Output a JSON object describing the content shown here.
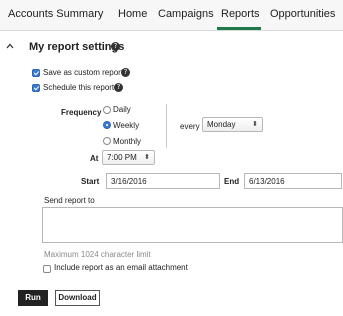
{
  "nav": {
    "tabs": [
      {
        "label": "Accounts Summary"
      },
      {
        "label": "Home"
      },
      {
        "label": "Campaigns"
      },
      {
        "label": "Reports"
      },
      {
        "label": "Opportunities"
      }
    ],
    "active_tab": "Reports"
  },
  "settings": {
    "title": "My report settings",
    "save_custom_label": "Save as custom report",
    "save_custom_checked": true,
    "schedule_label": "Schedule this report",
    "schedule_checked": true
  },
  "schedule": {
    "frequency_label": "Frequency",
    "options": [
      {
        "label": "Daily",
        "selected": false
      },
      {
        "label": "Weekly",
        "selected": true
      },
      {
        "label": "Monthly",
        "selected": false
      }
    ],
    "every_label": "every",
    "day_value": "Monday",
    "at_label": "At",
    "time_value": "7:00 PM",
    "start_label": "Start",
    "start_value": "3/16/2016",
    "end_label": "End",
    "end_value": "6/13/2016"
  },
  "send": {
    "label": "Send report to",
    "value": "",
    "limit_text": "Maximum 1024 character limit",
    "attachment_label": "Include report as an email attachment",
    "attachment_checked": false
  },
  "actions": {
    "run_label": "Run",
    "download_label": "Download"
  },
  "colors": {
    "accent": "#1f7a4b",
    "checkbox": "#3a7bd5"
  }
}
